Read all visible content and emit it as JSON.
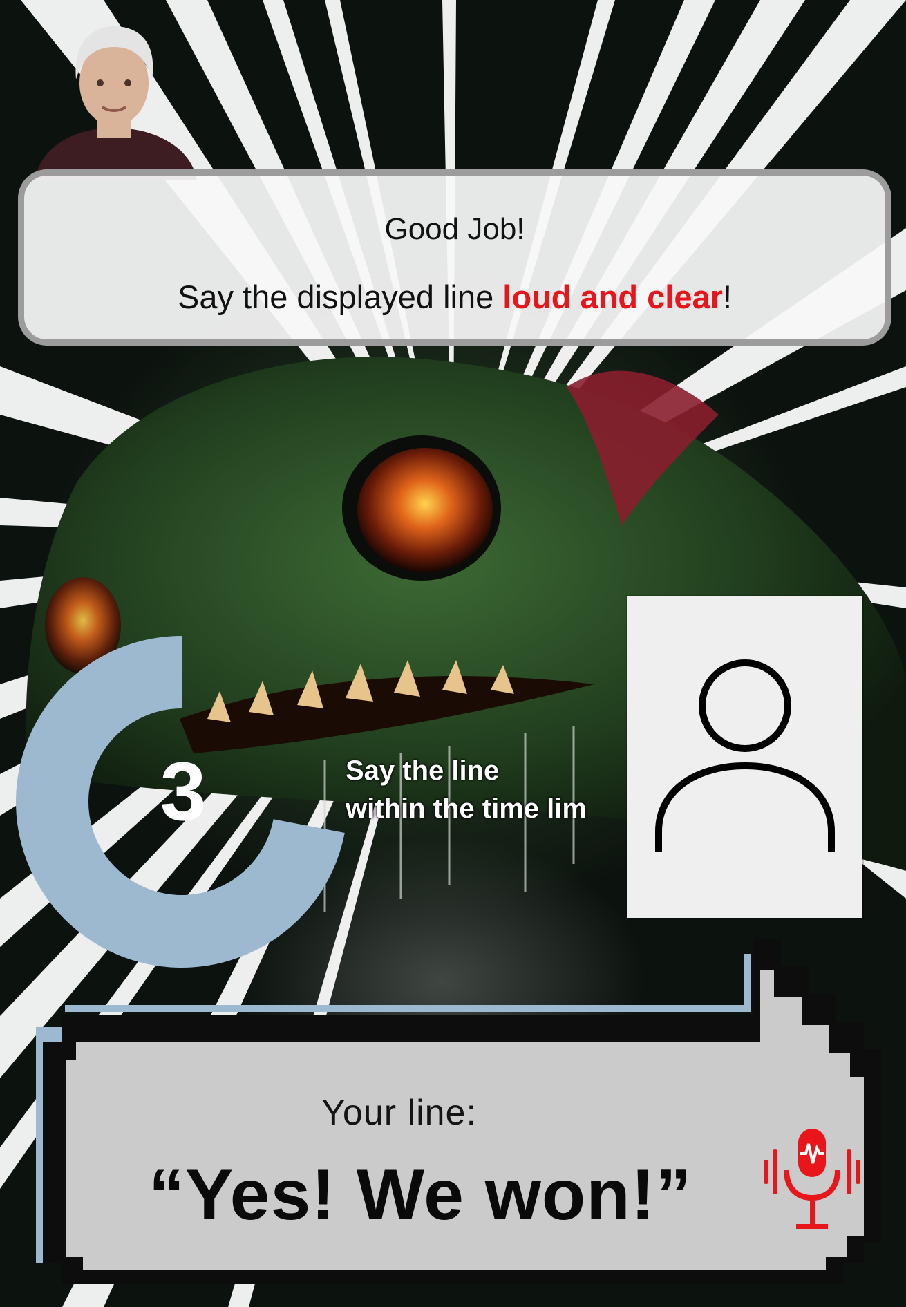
{
  "dialog": {
    "title": "Good Job!",
    "instruction_pre": "Say the displayed line ",
    "instruction_emphasis": "loud and clear",
    "instruction_post": "!"
  },
  "timer": {
    "count": "3",
    "remaining_fraction": 0.72,
    "hint_line1": "Say the line",
    "hint_line2": "within the time lim"
  },
  "player_card": {
    "icon": "user-icon"
  },
  "line_box": {
    "label": "Your line:",
    "quote": "“Yes! We won!”",
    "mic_icon": "microphone-icon"
  },
  "colors": {
    "emphasis": "#e8151b",
    "timer": "#9db9d0",
    "mic": "#e8151b"
  }
}
